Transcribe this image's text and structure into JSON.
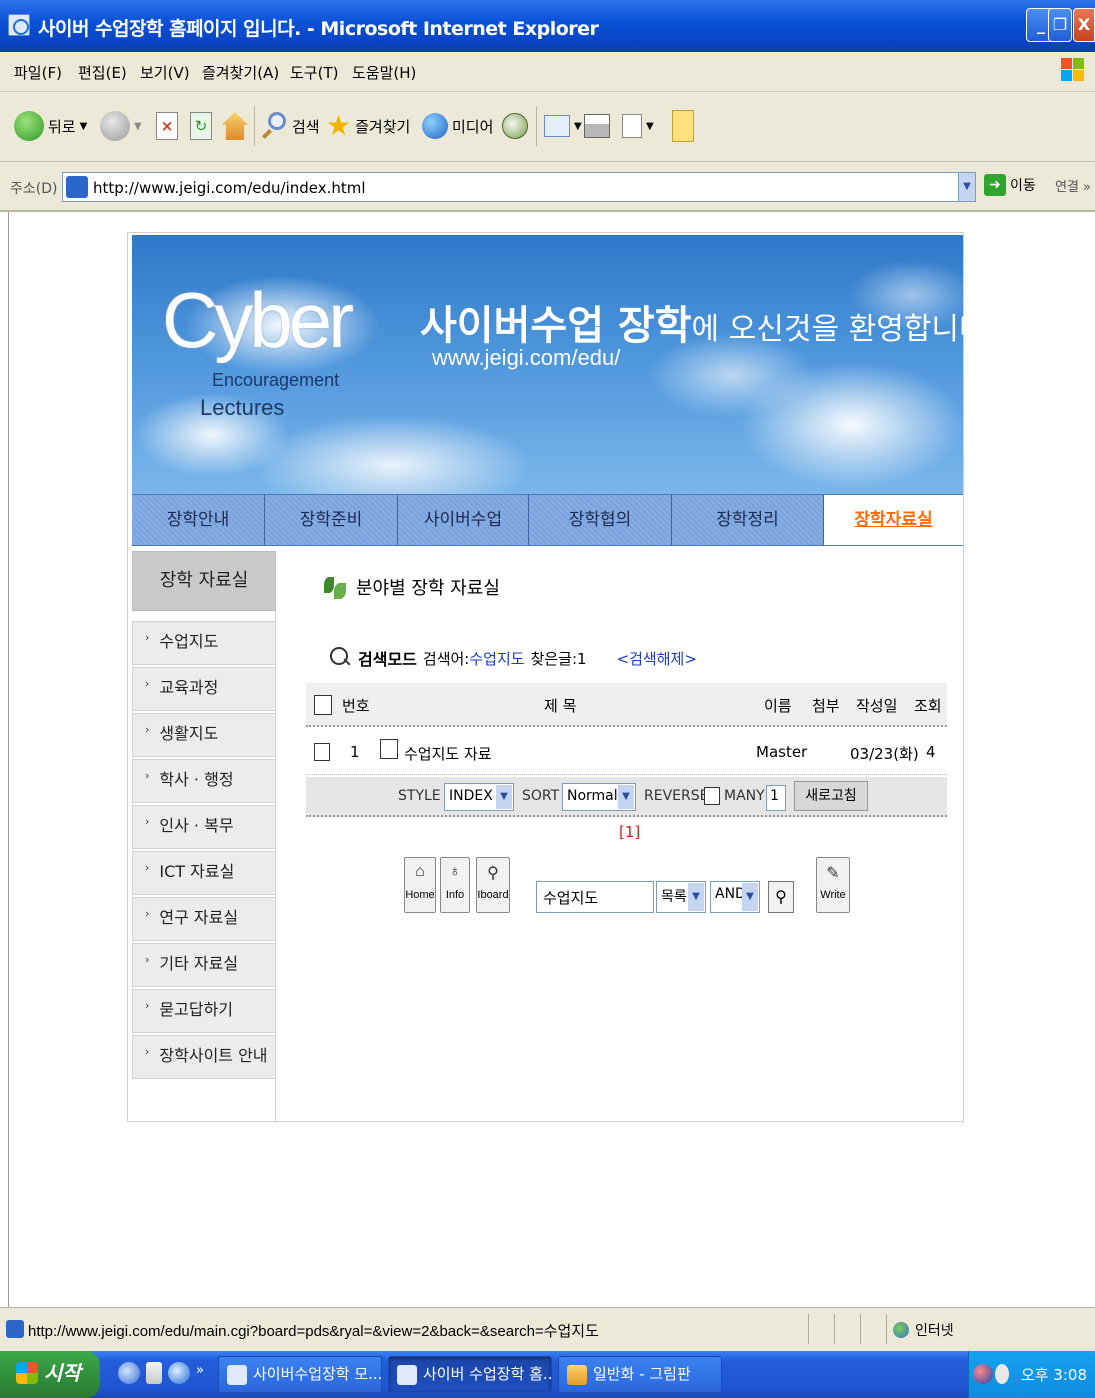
{
  "window": {
    "title": "사이버 수업장학 홈페이지 입니다. - Microsoft Internet Explorer",
    "min_label": "_",
    "max_label": "❐",
    "close_label": "X"
  },
  "menubar": {
    "items": [
      "파일(F)",
      "편집(E)",
      "보기(V)",
      "즐겨찾기(A)",
      "도구(T)",
      "도움말(H)"
    ]
  },
  "toolbar": {
    "back_label": "뒤로",
    "search_label": "검색",
    "favorites_label": "즐겨찾기",
    "media_label": "미디어"
  },
  "addressbar": {
    "label": "주소(D)",
    "url": "http://www.jeigi.com/edu/index.html",
    "go_label": "이동",
    "links_label": "연결 »"
  },
  "banner": {
    "logo_text": "Cyber",
    "logo_sub1": "Encouragement",
    "logo_sub2": "Lectures",
    "welcome_bold": "사이버수업 장학",
    "welcome_rest": "에 오신것을 환영합니다.",
    "site_url": "www.jeigi.com/edu/"
  },
  "nav": {
    "tabs": [
      "장학안내",
      "장학준비",
      "사이버수업",
      "장학협의",
      "장학정리",
      "장학자료실"
    ],
    "active_index": 5
  },
  "sidebar": {
    "header": "장학 자료실",
    "items": [
      "수업지도",
      "교육과정",
      "생활지도",
      "학사 · 행정",
      "인사 · 복무",
      "ICT 자료실",
      "연구 자료실",
      "기타 자료실",
      "묻고답하기",
      "장학사이트 안내"
    ]
  },
  "content": {
    "section_title": "분야별 장학 자료실",
    "search_mode": "검색모드",
    "search_term_label": "검색어:",
    "search_term": "수업지도",
    "found_label": "찾은글:1",
    "cancel_search": "<검색해제>",
    "columns": {
      "num": "번호",
      "title": "제 목",
      "name": "이름",
      "attach": "첨부",
      "date": "작성일",
      "views": "조회"
    },
    "rows": [
      {
        "num": "1",
        "title": "수업지도 자료",
        "name": "Master",
        "date": "03/23(화)",
        "views": "4"
      }
    ],
    "options": {
      "style_label": "STYLE",
      "style_value": "INDEX",
      "sort_label": "SORT",
      "sort_value": "Normal",
      "reverse_label": "REVERSE",
      "many_label": "MANY",
      "many_value": "1",
      "refresh_label": "새로고침"
    },
    "pager": "[1]",
    "bottom": {
      "home_label": "Home",
      "info_label": "Info",
      "iboard_label": "Iboard",
      "search_value": "수업지도",
      "field_select": "목록",
      "logic_select": "AND",
      "write_label": "Write"
    }
  },
  "statusbar": {
    "text": "http://www.jeigi.com/edu/main.cgi?board=pds&ryal=&view=2&back=&search=수업지도",
    "zone": "인터넷"
  },
  "taskbar": {
    "start_label": "시작",
    "tasks": [
      "사이버수업장학 모...",
      "사이버 수업장학 홈...",
      "일반화 - 그림판"
    ],
    "active_task": 1,
    "clock": "오후 3:08"
  },
  "colors": {
    "nav_active": "#ff6a00",
    "link_blue": "#1a3ebf",
    "pager_red": "#d21a1a"
  }
}
